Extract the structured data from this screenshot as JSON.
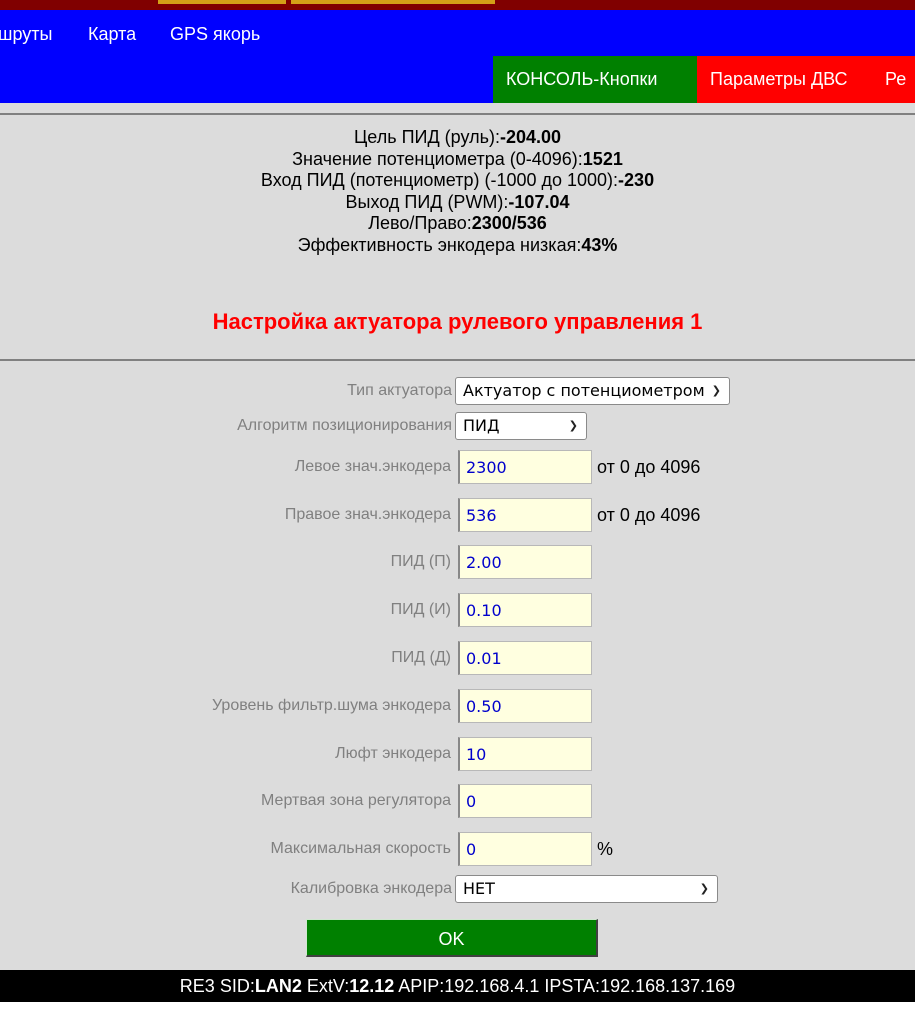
{
  "nav": {
    "links": [
      "шруты",
      "Карта",
      "GPS якорь"
    ],
    "tabs": [
      {
        "label": "КОНСОЛЬ-Кнопки",
        "color": "#008000"
      },
      {
        "label": "Параметры ДВС",
        "color": "#ff0000"
      },
      {
        "label": "Ре",
        "color": "#ff0000"
      }
    ]
  },
  "status": [
    {
      "label": "Цель ПИД (руль):",
      "value": "-204.00"
    },
    {
      "label": "Значение потенциометра (0-4096):",
      "value": "1521"
    },
    {
      "label": "Вход ПИД (потенциометр) (-1000 до 1000):",
      "value": "-230"
    },
    {
      "label": "Выход ПИД (PWM):",
      "value": "-107.04"
    },
    {
      "label": "Лево/Право:",
      "value": "2300/536"
    },
    {
      "label": "Эффективность энкодера низкая:",
      "value": "43%"
    }
  ],
  "heading": "Настройка актуатора рулевого управления 1",
  "form": {
    "actuator_type": {
      "label": "Тип актуатора",
      "value": "Актуатор с потенциометром"
    },
    "algorithm": {
      "label": "Алгоритм позиционирования",
      "value": "ПИД"
    },
    "fields": [
      {
        "label": "Левое знач.энкодера",
        "value": "2300",
        "suffix": "от 0 до 4096"
      },
      {
        "label": "Правое знач.энкодера",
        "value": "536",
        "suffix": "от 0 до 4096"
      },
      {
        "label": "ПИД (П)",
        "value": "2.00",
        "suffix": ""
      },
      {
        "label": "ПИД (И)",
        "value": "0.10",
        "suffix": ""
      },
      {
        "label": "ПИД (Д)",
        "value": "0.01",
        "suffix": ""
      },
      {
        "label": "Уровень фильтр.шума энкодера",
        "value": "0.50",
        "suffix": ""
      },
      {
        "label": "Люфт энкодера",
        "value": "10",
        "suffix": ""
      },
      {
        "label": "Мертвая зона регулятора",
        "value": "0",
        "suffix": ""
      },
      {
        "label": "Максимальная скорость",
        "value": "0",
        "suffix": "%"
      }
    ],
    "calibration": {
      "label": "Калибровка энкодера",
      "value": "НЕТ"
    },
    "ok_label": "OK"
  },
  "footer": {
    "re_label": "RE3 SID:",
    "sid": "LAN2",
    "extv_label": " ExtV:",
    "extv": "12.12",
    "apip_label": " APIP:",
    "apip": "192.168.4.1",
    "ipsta_label": " IPSTA:",
    "ipsta": "192.168.137.169"
  },
  "colors": {
    "nav_bg": "#0000ff",
    "content_bg": "#dcdcdc",
    "heading": "#ff0000",
    "input_bg": "#ffffe0",
    "ok_bg": "#008000"
  }
}
